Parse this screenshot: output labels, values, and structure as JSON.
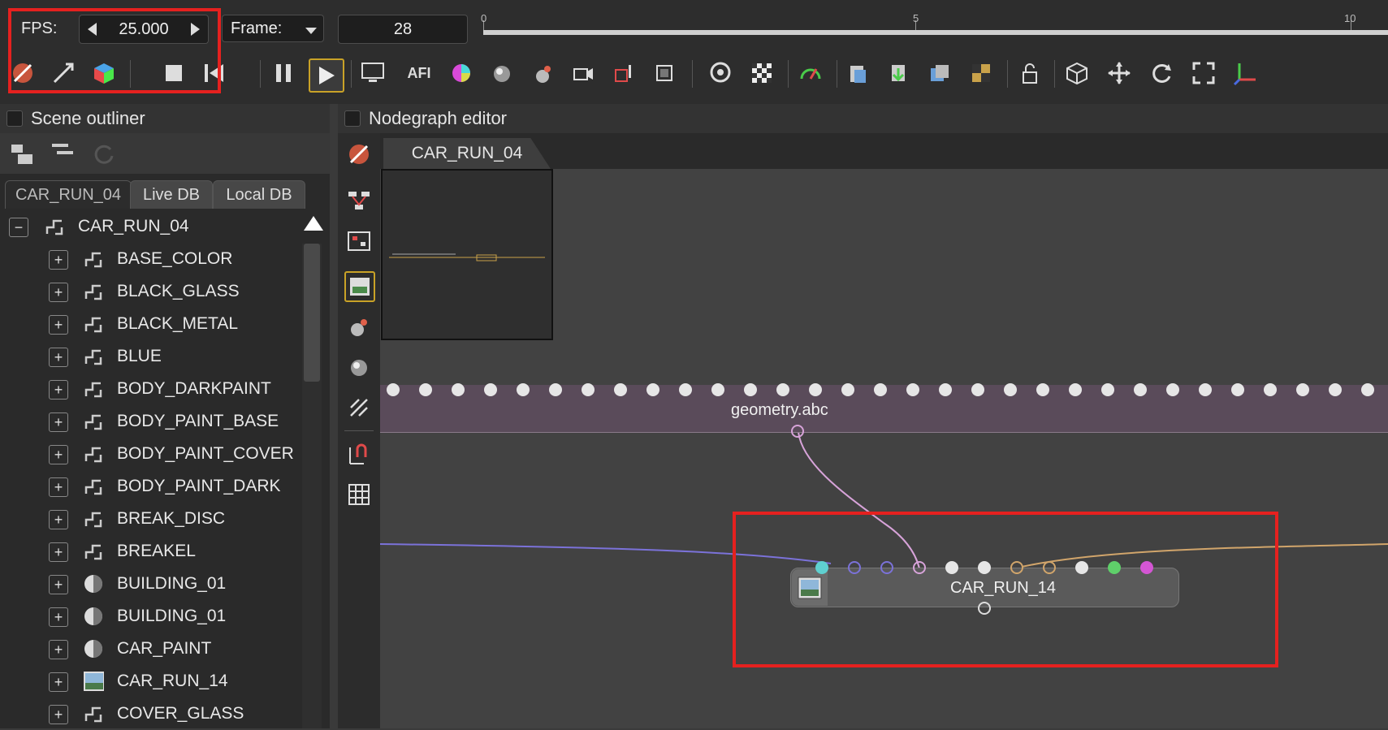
{
  "toolbar": {
    "fps_label": "FPS:",
    "fps_value": "25.000",
    "frame_label": "Frame:",
    "frame_value": "28",
    "timeline_ticks": [
      "0",
      "5",
      "10"
    ],
    "afi_label": "AFI"
  },
  "outliner": {
    "title": "Scene outliner",
    "tabs": [
      "CAR_RUN_04",
      "Live DB",
      "Local DB"
    ],
    "root": "CAR_RUN_04",
    "items": [
      {
        "label": "BASE_COLOR",
        "icon": "texture-icon"
      },
      {
        "label": "BLACK_GLASS",
        "icon": "texture-icon"
      },
      {
        "label": "BLACK_METAL",
        "icon": "texture-icon"
      },
      {
        "label": "BLUE",
        "icon": "texture-icon"
      },
      {
        "label": "BODY_DARKPAINT",
        "icon": "texture-icon"
      },
      {
        "label": "BODY_PAINT_BASE",
        "icon": "texture-icon"
      },
      {
        "label": "BODY_PAINT_COVER",
        "icon": "texture-icon"
      },
      {
        "label": "BODY_PAINT_DARK",
        "icon": "texture-icon"
      },
      {
        "label": "BREAK_DISC",
        "icon": "texture-icon"
      },
      {
        "label": "BREAKEL",
        "icon": "texture-icon"
      },
      {
        "label": "BUILDING_01",
        "icon": "material-sphere-icon"
      },
      {
        "label": "BUILDING_01",
        "icon": "material-sphere-icon"
      },
      {
        "label": "CAR_PAINT",
        "icon": "material-sphere-icon"
      },
      {
        "label": "CAR_RUN_14",
        "icon": "image-icon"
      },
      {
        "label": "COVER_GLASS",
        "icon": "texture-icon"
      }
    ]
  },
  "nodegraph": {
    "title": "Nodegraph editor",
    "tab": "CAR_RUN_04",
    "geometry_node": "geometry.abc",
    "render_node": "CAR_RUN_14"
  },
  "colors": {
    "highlight": "#e5211f",
    "link_purple": "#7b72d9",
    "link_pink": "#d7a3d9",
    "link_orange": "#d1a56b"
  }
}
